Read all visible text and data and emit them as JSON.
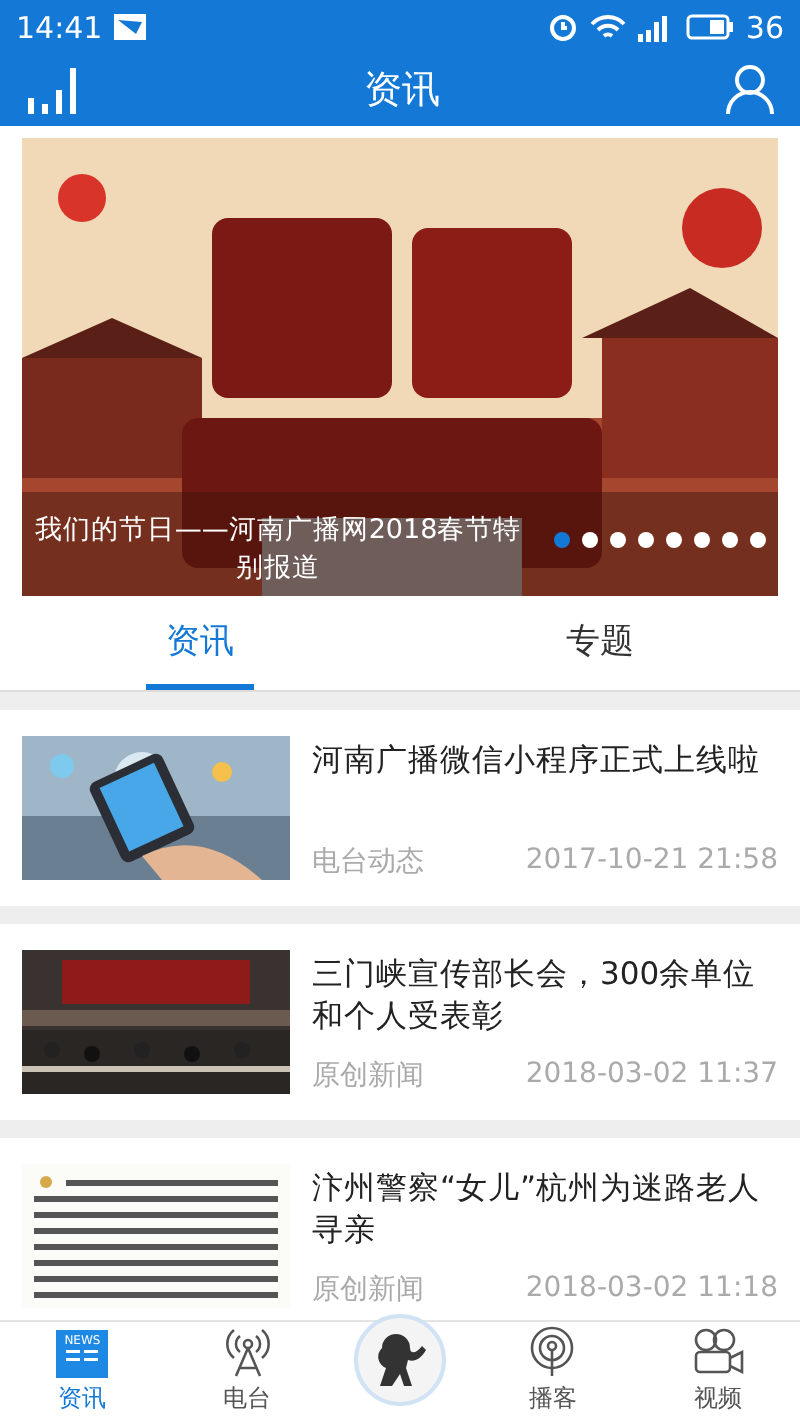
{
  "status_bar": {
    "time": "14:41",
    "battery": "36"
  },
  "header": {
    "title": "资讯"
  },
  "banner": {
    "caption": "我们的节日——河南广播网2018春节特别报道",
    "dots": [
      {
        "selected": true
      },
      {
        "selected": false
      },
      {
        "selected": false
      },
      {
        "selected": false
      },
      {
        "selected": false
      },
      {
        "selected": false
      },
      {
        "selected": false
      },
      {
        "selected": false
      }
    ]
  },
  "tabs": [
    {
      "label": "资讯",
      "selected": true
    },
    {
      "label": "专题",
      "selected": false
    }
  ],
  "articles": [
    {
      "title": "河南广播微信小程序正式上线啦",
      "source": "电台动态",
      "time": "2017-10-21 21:58",
      "kind": "phone"
    },
    {
      "title": "三门峡宣传部长会，300余单位和个人受表彰",
      "source": "原创新闻",
      "time": "2018-03-02 11:37",
      "kind": "meeting"
    },
    {
      "title": "汴州警察“女儿”杭州为迷路老人寻亲",
      "source": "原创新闻",
      "time": "2018-03-02 11:18",
      "kind": "document"
    }
  ],
  "bottom_nav": [
    {
      "label": "资讯",
      "kind": "news",
      "icon_text": "NEWS",
      "selected": true
    },
    {
      "label": "电台",
      "kind": "radio",
      "selected": false
    },
    {
      "kind": "center"
    },
    {
      "label": "播客",
      "kind": "podcast",
      "selected": false
    },
    {
      "label": "视频",
      "kind": "video",
      "selected": false
    }
  ]
}
